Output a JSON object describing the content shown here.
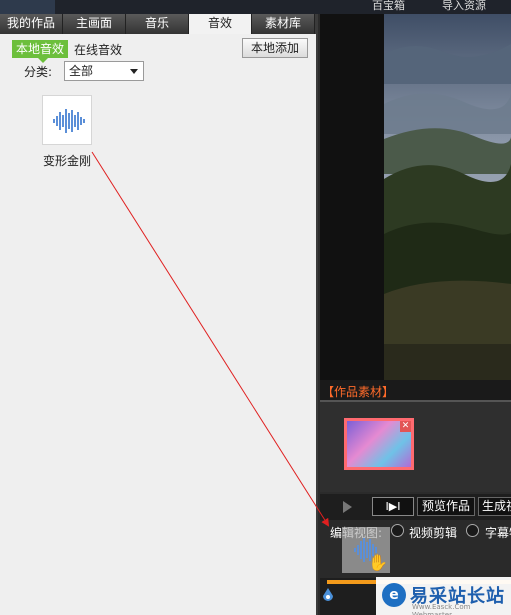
{
  "top_bar": {
    "item1": "百宝箱",
    "item2": "导入资源"
  },
  "tabs": [
    {
      "label": "我的作品"
    },
    {
      "label": "主画面"
    },
    {
      "label": "音乐"
    },
    {
      "label": "音效"
    },
    {
      "label": "素材库"
    }
  ],
  "active_tab": "音效",
  "sub_tabs": {
    "active": "本地音效",
    "other": "在线音效"
  },
  "local_add_label": "本地添加",
  "category": {
    "label": "分类:",
    "selected": "全部"
  },
  "sound_item": {
    "label": "变形金刚",
    "icon": "waveform-icon"
  },
  "assets": {
    "title": "【作品素材】"
  },
  "controls": {
    "frame_label": "I▶I",
    "preview_label": "预览作品",
    "generate_label": "生成视频"
  },
  "edit_view": {
    "label": "编辑视图:",
    "option1": "视频剪辑",
    "option2": "字幕特效"
  },
  "watermark": {
    "main": "易采站长站",
    "sub": "Www.Easck.Com Webmaster"
  },
  "colors": {
    "accent_green": "#6cbf3c",
    "assets_orange": "#ff6b2a",
    "timeline": "#f39a1b",
    "arrow": "#e02020"
  }
}
